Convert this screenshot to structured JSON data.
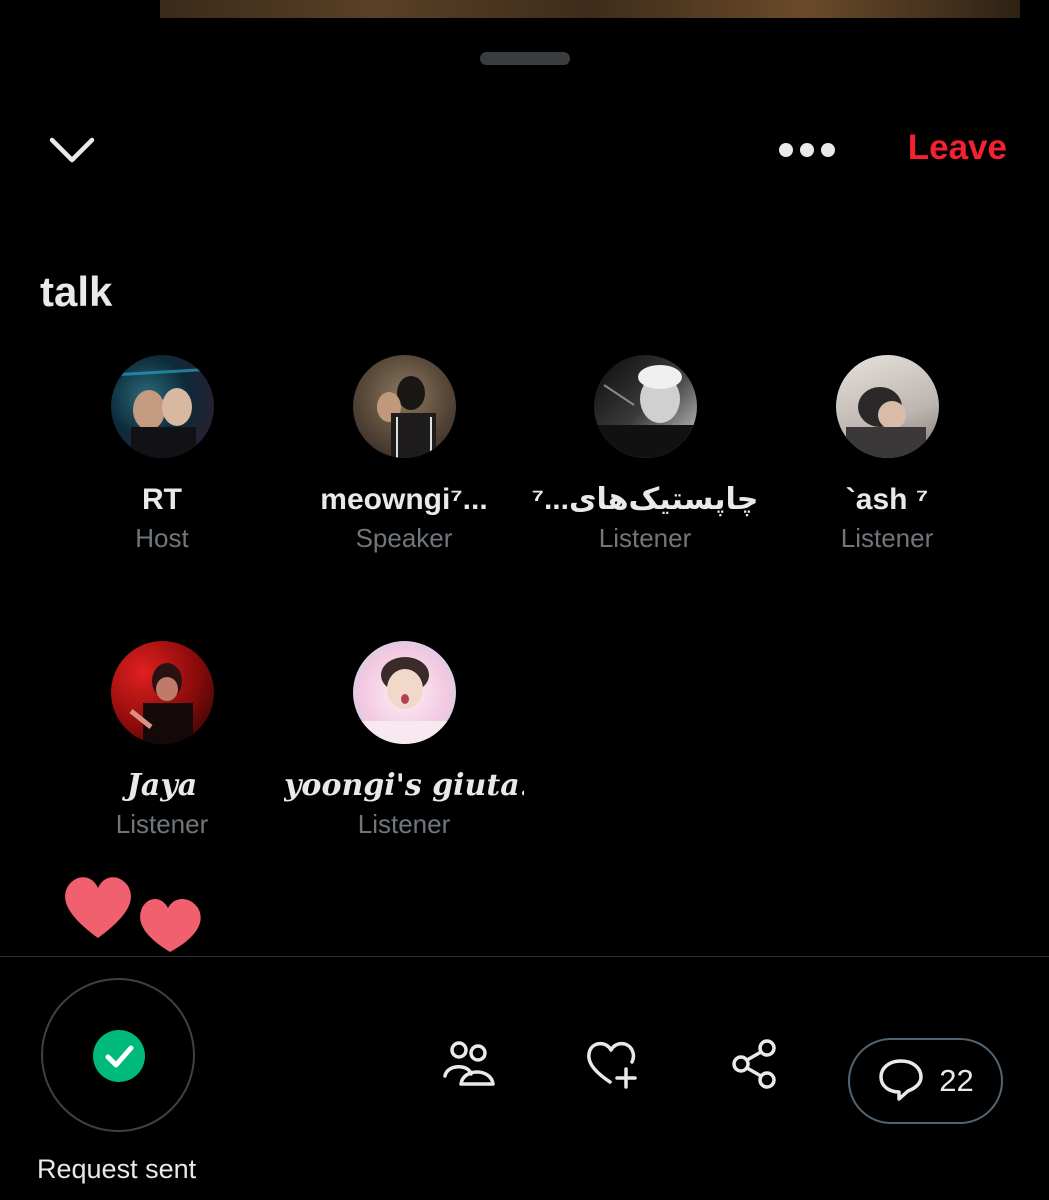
{
  "header": {
    "close_icon": "chevron-down-icon",
    "more_icon": "more-horizontal-icon",
    "leave_label": "Leave",
    "leave_color": "#f4212e"
  },
  "space": {
    "title": "talk"
  },
  "participants": [
    {
      "name": "RT",
      "role": "Host",
      "avatar_colors": [
        "#0d2a3a",
        "#1a5a6a",
        "#3a1a2a"
      ]
    },
    {
      "name": "meowngi⁷...",
      "role": "Speaker",
      "avatar_colors": [
        "#5a4a3a",
        "#2a2220",
        "#8a7a60"
      ]
    },
    {
      "name": "چاپستیک‌های...⁷",
      "role": "Listener",
      "avatar_colors": [
        "#1a1a1a",
        "#9a9a9a",
        "#e0e0e0"
      ]
    },
    {
      "name": "`ash ⁷",
      "role": "Listener",
      "avatar_colors": [
        "#c9c2bc",
        "#3a3838",
        "#8a8480"
      ]
    },
    {
      "name": "Jaya",
      "role": "Listener",
      "avatar_colors": [
        "#8a0a0a",
        "#d01818",
        "#1a0606"
      ]
    },
    {
      "name": "yoongi's giuta...",
      "role": "Listener",
      "avatar_colors": [
        "#f2c8e0",
        "#a8d8f0",
        "#fff0f6"
      ]
    }
  ],
  "reactions": {
    "hearts": 2,
    "heart_color": "#f0606e"
  },
  "bottom_bar": {
    "request_status": "Request sent",
    "check_color": "#00ba7c",
    "people_icon": "people-icon",
    "react_icon": "heart-plus-icon",
    "share_icon": "share-icon",
    "comment_icon": "comment-icon",
    "comment_count": "22"
  }
}
